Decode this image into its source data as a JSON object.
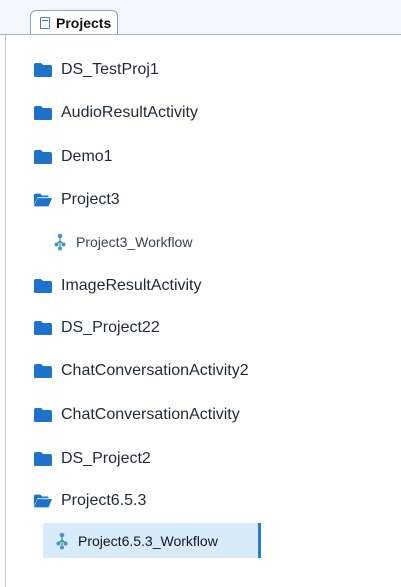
{
  "panel": {
    "tab_label": "Projects",
    "tab_icon": "document-icon"
  },
  "tree": {
    "items": [
      {
        "label": "DS_TestProj1",
        "kind": "folder",
        "expanded": false
      },
      {
        "label": "AudioResultActivity",
        "kind": "folder",
        "expanded": false
      },
      {
        "label": "Demo1",
        "kind": "folder",
        "expanded": false
      },
      {
        "label": "Project3",
        "kind": "folder",
        "expanded": true
      },
      {
        "label": "Project3_Workflow",
        "kind": "workflow"
      },
      {
        "label": "ImageResultActivity",
        "kind": "folder",
        "expanded": false
      },
      {
        "label": "DS_Project22",
        "kind": "folder",
        "expanded": false
      },
      {
        "label": "ChatConversationActivity2",
        "kind": "folder",
        "expanded": false
      },
      {
        "label": "ChatConversationActivity",
        "kind": "folder",
        "expanded": false
      },
      {
        "label": "DS_Project2",
        "kind": "folder",
        "expanded": false
      },
      {
        "label": "Project6.5.3",
        "kind": "folder",
        "expanded": true
      },
      {
        "label": "Project6.5.3_Workflow",
        "kind": "workflow",
        "selected": true
      }
    ]
  },
  "colors": {
    "folder": "#1d73c9",
    "selection_bg": "#d8ebfa",
    "selection_border": "#2b7bd3",
    "workflow_icon": "#4f8fd6"
  }
}
